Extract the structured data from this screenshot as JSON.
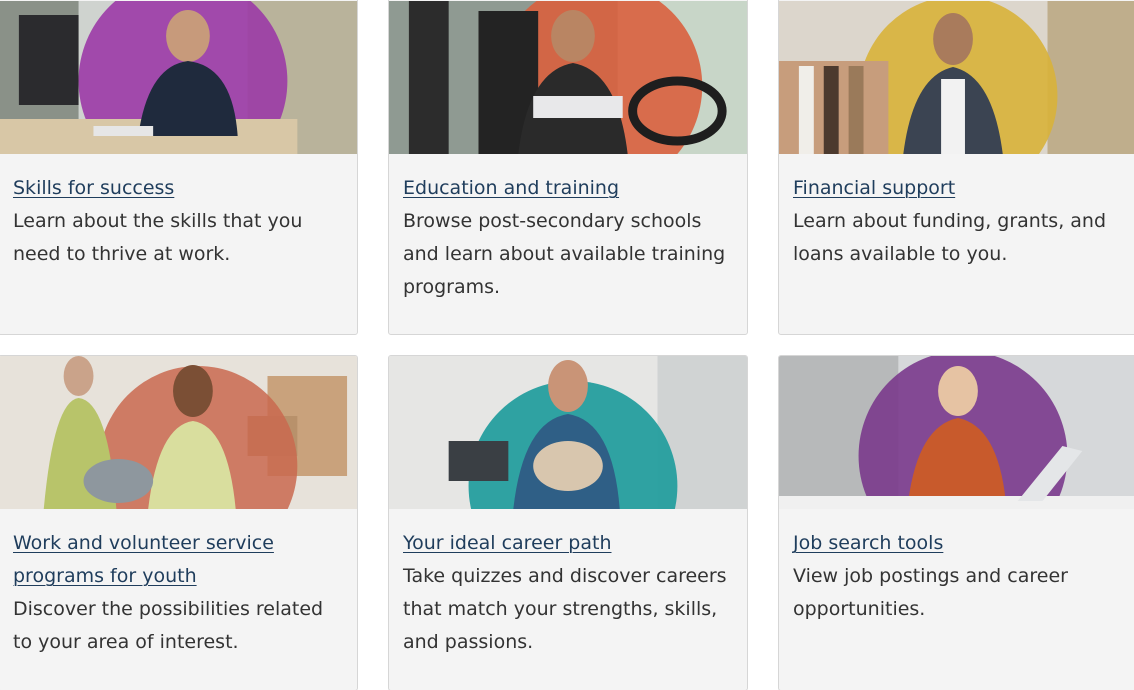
{
  "cards": [
    {
      "title": "Skills for success",
      "description": "Learn about the skills that you need to thrive at work.",
      "accent": "#9b3aa6"
    },
    {
      "title": "Education and training",
      "description": "Browse post-secondary schools and learn about available training programs.",
      "accent": "#d9603e"
    },
    {
      "title": "Financial support",
      "description": "Learn about funding, grants, and loans available to you.",
      "accent": "#d8b23a"
    },
    {
      "title": "Work and volunteer service programs for youth",
      "description": "Discover the possibilities related to your area of interest.",
      "accent": "#c9684f"
    },
    {
      "title": "Your ideal career path",
      "description": "Take quizzes and discover careers that match your strengths, skills, and passions.",
      "accent": "#1f9c9c"
    },
    {
      "title": "Job search tools",
      "description": "View job postings and career opportunities.",
      "accent": "#7a3a8c"
    }
  ],
  "colors": {
    "link": "#1f3d5c",
    "text": "#333333",
    "card_bg": "#f4f4f4",
    "card_border": "#d6d6d6"
  }
}
